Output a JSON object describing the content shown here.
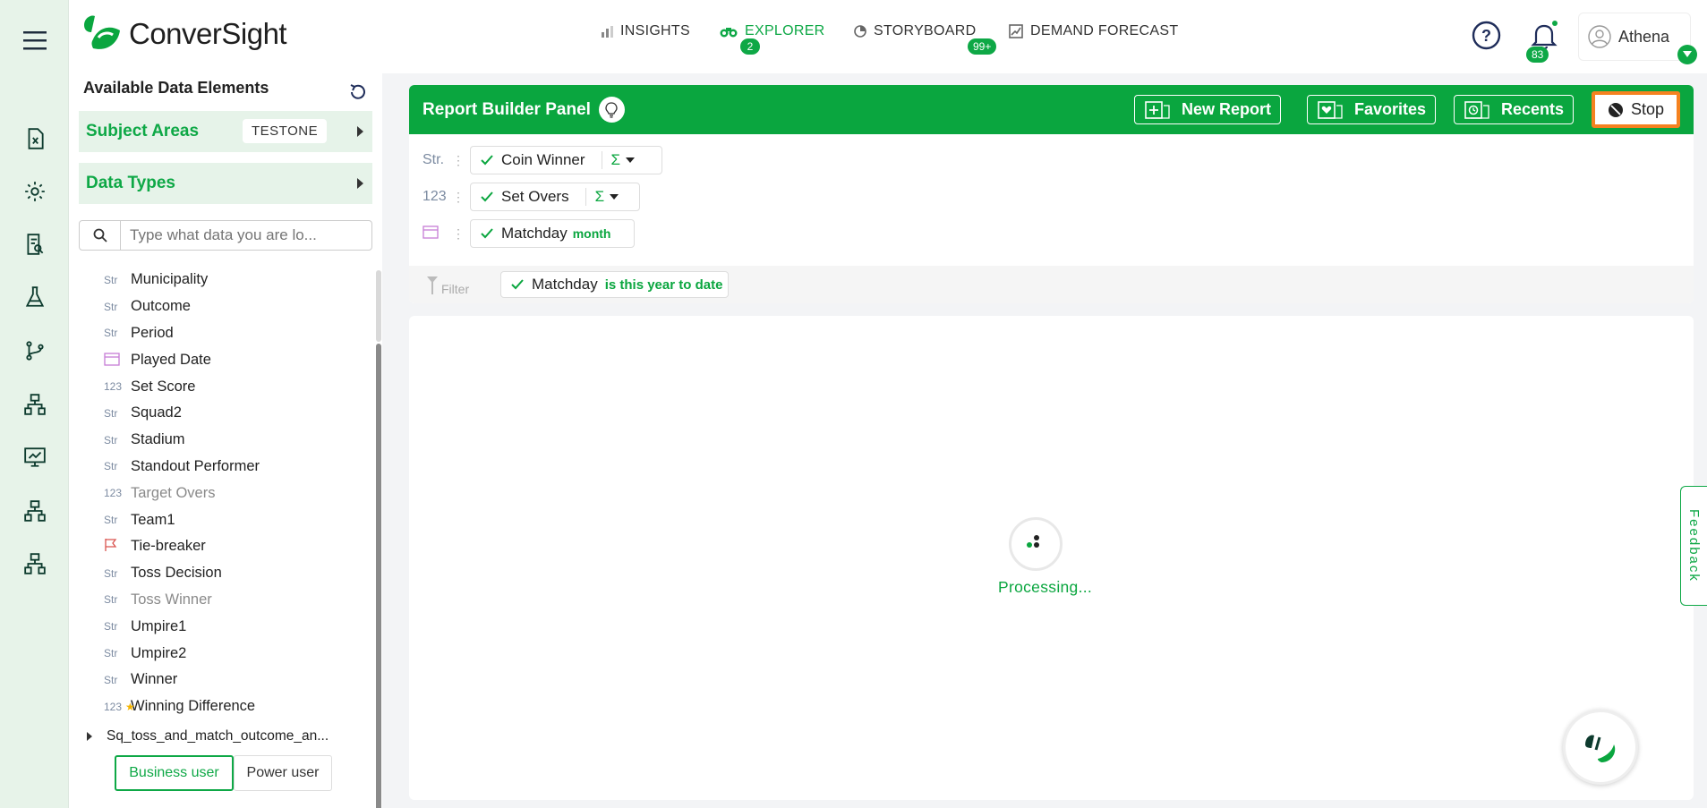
{
  "brand": {
    "name": "ConverSight",
    "accent": "#0aa63f"
  },
  "nav": {
    "insights": {
      "label": "INSIGHTS",
      "badge": "2"
    },
    "explorer": {
      "label": "EXPLORER"
    },
    "storyboard": {
      "label": "STORYBOARD",
      "badge": "99+"
    },
    "demand": {
      "label": "DEMAND FORECAST"
    }
  },
  "notifications": {
    "count": "83"
  },
  "user": {
    "name": "Athena"
  },
  "sidebar": {
    "title": "Available Data Elements",
    "subject_areas": {
      "label": "Subject Areas",
      "value": "TESTONE"
    },
    "data_types": {
      "label": "Data Types"
    },
    "search_placeholder": "Type what data you are lo...",
    "fields": [
      {
        "type": "Str",
        "label": "Municipality"
      },
      {
        "type": "Str",
        "label": "Outcome"
      },
      {
        "type": "Str",
        "label": "Period"
      },
      {
        "type": "date",
        "label": "Played Date"
      },
      {
        "type": "123",
        "label": "Set Score"
      },
      {
        "type": "Str",
        "label": "Squad2"
      },
      {
        "type": "Str",
        "label": "Stadium"
      },
      {
        "type": "Str",
        "label": "Standout Performer"
      },
      {
        "type": "123",
        "label": "Target Overs"
      },
      {
        "type": "Str",
        "label": "Team1"
      },
      {
        "type": "flag",
        "label": "Tie-breaker"
      },
      {
        "type": "Str",
        "label": "Toss Decision"
      },
      {
        "type": "Str",
        "label": "Toss Winner"
      },
      {
        "type": "Str",
        "label": "Umpire1"
      },
      {
        "type": "Str",
        "label": "Umpire2"
      },
      {
        "type": "Str",
        "label": "Winner"
      },
      {
        "type": "123",
        "label": "Winning Difference"
      }
    ],
    "subject_item": "Sq_toss_and_match_outcome_an...",
    "modes": {
      "business": "Business user",
      "power": "Power user"
    }
  },
  "report_builder": {
    "title": "Report Builder Panel",
    "buttons": {
      "new_report": "New Report",
      "favorites": "Favorites",
      "recents": "Recents",
      "stop": "Stop"
    },
    "rows": [
      {
        "type": "Str.",
        "label": "Coin Winner",
        "agg": "Σ"
      },
      {
        "type": "123",
        "label": "Set Overs",
        "agg": "Σ"
      },
      {
        "type": "date",
        "label": "Matchday",
        "modifier": "month"
      }
    ],
    "filter": {
      "label": "Filter",
      "field": "Matchday",
      "condition": "is this year to date"
    }
  },
  "result": {
    "status": "Processing..."
  },
  "feedback": "Feedback"
}
